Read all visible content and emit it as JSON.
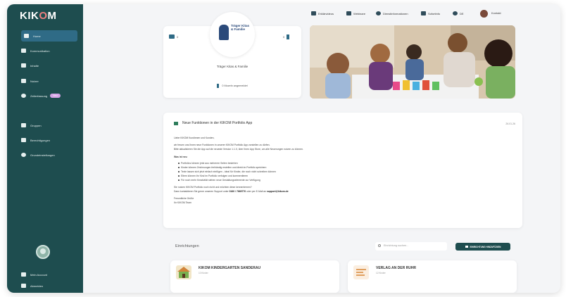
{
  "sidebar": {
    "logo": "KIKOM",
    "items": [
      {
        "label": "Home",
        "icon": "home-icon"
      },
      {
        "label": "Kommunikation",
        "icon": "chat-icon"
      },
      {
        "label": "Inhalte",
        "icon": "content-icon"
      },
      {
        "label": "Nutzer",
        "icon": "users-icon"
      },
      {
        "label": "Zeiterfassung",
        "icon": "clock-icon",
        "badge": "Neu"
      },
      {
        "label": "Gruppen",
        "icon": "groups-icon"
      },
      {
        "label": "Berechtigungen",
        "icon": "permissions-icon"
      },
      {
        "label": "Grundeinstellungen",
        "icon": "settings-icon"
      }
    ],
    "bottom": [
      {
        "label": "Mein Account",
        "icon": "account-icon"
      },
      {
        "label": "Abmelden",
        "icon": "logout-icon"
      }
    ]
  },
  "topbar": {
    "items": [
      {
        "label": "Erklärvideos",
        "icon": "video-icon"
      },
      {
        "label": "Webinare",
        "icon": "webinar-icon"
      },
      {
        "label": "Dienstinformationen",
        "icon": "info-icon"
      },
      {
        "label": "Sofortinfo",
        "icon": "news-icon"
      },
      {
        "label": "DE",
        "icon": "language-icon"
      }
    ],
    "contact_label": "Kontakt"
  },
  "profile": {
    "logo_text": "Träger Kitas & Familie",
    "name": "Träger Kitas & Familie",
    "left_count": "0",
    "right_count": "0",
    "footer": "0 Mozeln angemeldet"
  },
  "news": {
    "title": "Neue Funktionen in der KIKOM Portfolio App",
    "date": "26.01.26",
    "greeting": "Liebe KIKOM Kundinnen und Kunden,",
    "intro1": "wir freuen uns Ihnen neue Funktionen in unserer KIKOM Portfolio App vorstellen zu dürfen.",
    "intro2": "Bitte aktualisieren Sie die App auf die neueste Version 1.1.0, über Ihren App Store, um alle Neuerungen nutzen zu können.",
    "section_title": "Was ist neu",
    "bullets": [
      "Portfolios können jetzt aus mehreren Seiten bestehen",
      "Kinder können Zeichnungen freihändig erstellen und direkt im Portfolio speichern",
      "Texte lassen sich jetzt einfach einfügen - ideal für Kinder, die noch nicht schreiben können",
      "Eltern können ihr Kind im Portfolio verfolgen und kommentieren",
      "Für noch mehr Kreativität stehen neue Gestaltungselemente zur Verfügung"
    ],
    "outro1": "Sie nutzen KIKOM Portfolio noch nicht und möchten diese kennenlernen?",
    "outro2_prefix": "Dann kontaktieren Sie gerne unseren Support unter",
    "phone": "0160 / 7669770",
    "outro2_mid": "oder per E-Mail an",
    "email": "support@kikom.de",
    "signoff1": "Freundliche Grüße",
    "signoff2": "Ihr KIKOM Team"
  },
  "einrichtungen": {
    "title": "Einrichtungen",
    "search_placeholder": "Einrichtung suchen...",
    "add_button": "EINRICHTUNG HINZUFÜGEN",
    "items": [
      {
        "name": "KIKOM KINDERGARTEN SANDERAU",
        "sub": "10 Kinder"
      },
      {
        "name": "VERLAG AN DER RUHR",
        "sub": "12 Kinder"
      }
    ]
  },
  "colors": {
    "sidebar": "#1e4d4f",
    "active": "#2f6b86",
    "badge": "#d4a3e6",
    "button": "#1e4d4f"
  }
}
